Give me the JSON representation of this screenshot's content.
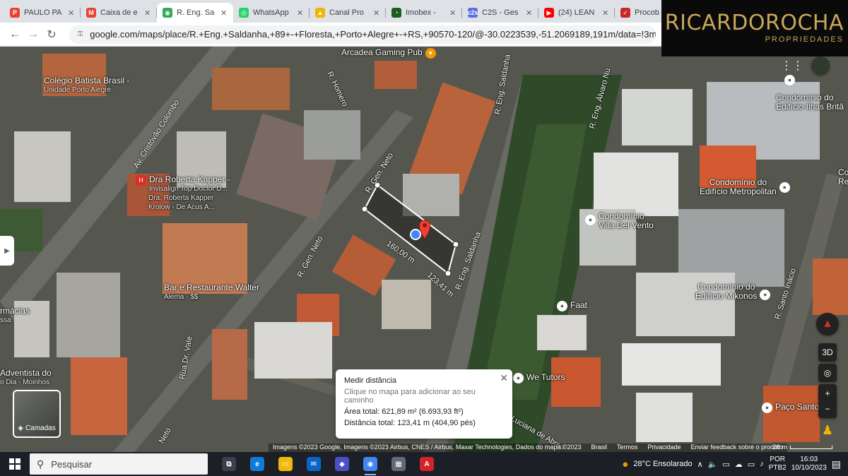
{
  "tabs": [
    {
      "label": "PAULO PA",
      "color": "#e94235",
      "glyph": "P",
      "active": false
    },
    {
      "label": "Caixa de e",
      "color": "#ea4335",
      "glyph": "M",
      "active": false
    },
    {
      "label": "R. Eng. Sa",
      "color": "#34a853",
      "glyph": "◉",
      "active": true
    },
    {
      "label": "WhatsApp",
      "color": "#25d366",
      "glyph": "◎",
      "active": false
    },
    {
      "label": "Canal Pro",
      "color": "#f4b400",
      "glyph": "▲",
      "active": false
    },
    {
      "label": "Imobex -",
      "color": "#1b5e20",
      "glyph": "◔",
      "active": false
    },
    {
      "label": "C2S - Ges",
      "color": "#5b6ee1",
      "glyph": "c2s",
      "active": false
    },
    {
      "label": "(24) LEAN",
      "color": "#ff0000",
      "glyph": "▶",
      "active": false
    },
    {
      "label": "Procob | S",
      "color": "#c62828",
      "glyph": "✓",
      "active": false
    }
  ],
  "address": {
    "url": "google.com/maps/place/R.+Eng.+Saldanha,+89+-+Floresta,+Porto+Alegre+-+RS,+90570-120/@-30.0223539,-51.2069189,191m/data=!3m1!1e3!4m"
  },
  "logo": {
    "brand": "RICARDOROCHA",
    "sub": "PROPRIEDADES",
    "color": "#c9a75a"
  },
  "map": {
    "streets": [
      {
        "text": "Av. Cristóvão Colombo"
      },
      {
        "text": "R. Gen. Neto"
      },
      {
        "text": "R. Gen. Neto"
      },
      {
        "text": "R. Eng. Saldanha"
      },
      {
        "text": "R. Eng. Saldanha"
      },
      {
        "text": "R. Eng. Álvaro Nu"
      },
      {
        "text": "R. Santo Inácio"
      },
      {
        "text": "Rua Dr. Vale"
      },
      {
        "text": "Luciana de Abreu"
      },
      {
        "text": "R. Homero"
      },
      {
        "text": "Neto"
      }
    ],
    "pois": [
      {
        "name": "Arcadea Gaming Pub",
        "sub": ""
      },
      {
        "name": "Colégio Batista Brasil -",
        "sub": "Unidade Porto Alegre"
      },
      {
        "name": "Dra Roberta Kapper -",
        "sub": "Invisalign Top Doctor D..."
      },
      {
        "name": "Dra. Roberta Kapper",
        "sub": "Krolow - De Acus A..."
      },
      {
        "name": "Bar e Restaurante Walter",
        "sub": "Alema · $$"
      },
      {
        "name": "rmácias",
        "sub": "ssa"
      },
      {
        "name": "Adventista do",
        "sub": "o Dia - Moinhos"
      },
      {
        "name": "Condomínio do",
        "sub": "Edifício Ilhas Britâ"
      },
      {
        "name": "Condomínio do",
        "sub": "Edifício Metropolitan"
      },
      {
        "name": "Condomínio",
        "sub": "Villa Del Vento"
      },
      {
        "name": "Condomínio do",
        "sub": "Edifício Mikonos"
      },
      {
        "name": "Faat",
        "sub": ""
      },
      {
        "name": "We Tutors",
        "sub": ""
      },
      {
        "name": "Paço Santo",
        "sub": ""
      },
      {
        "name": "Co",
        "sub": "Re"
      }
    ],
    "segment_labels": {
      "side_a": "160,00 m",
      "side_b": "123,41 m"
    },
    "layers_label": "Camadas",
    "attribution": [
      "Imagens ©2023 Google, Imagens ©2023 Airbus, CNES / Airbus, Maxar Technologies, Dados do mapa ©2023",
      "Brasil",
      "Termos",
      "Privacidade",
      "Enviar feedback sobre o produto"
    ],
    "scale": "20 m",
    "controls": {
      "three_d": "3D"
    }
  },
  "measure": {
    "title": "Medir distância",
    "hint": "Clique no mapa para adicionar ao seu caminho",
    "area": "Área total: 621,89 m² (6.693,93 ft²)",
    "distance": "Distância total: 123,41 m (404,90 pés)"
  },
  "taskbar": {
    "search_placeholder": "Pesquisar",
    "apps": [
      {
        "name": "task-view",
        "color": "#3a3f4b",
        "glyph": "⧉",
        "running": false
      },
      {
        "name": "edge",
        "color": "#0f7bd7",
        "glyph": "e",
        "running": false
      },
      {
        "name": "file-explorer",
        "color": "#f2b90d",
        "glyph": "▭",
        "running": false
      },
      {
        "name": "mail",
        "color": "#0a64c8",
        "glyph": "✉",
        "running": false
      },
      {
        "name": "vpn",
        "color": "#4b4fc8",
        "glyph": "◆",
        "running": false
      },
      {
        "name": "chrome",
        "color": "#4285f4",
        "glyph": "◉",
        "running": true
      },
      {
        "name": "calculator",
        "color": "#5f6b7a",
        "glyph": "▦",
        "running": false
      },
      {
        "name": "acrobat",
        "color": "#d2232a",
        "glyph": "A",
        "running": false
      }
    ],
    "weather": "28°C Ensolarado",
    "lang": "POR",
    "layout": "PTB2",
    "time": "16:03",
    "date": "10/10/2023"
  }
}
